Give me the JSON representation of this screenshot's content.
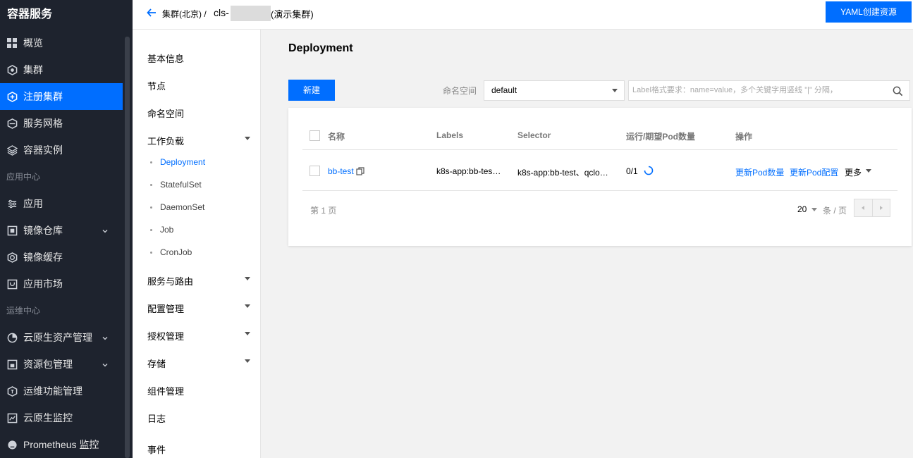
{
  "sidebar": {
    "brand": "容器服务",
    "items_top": [
      {
        "label": "概览",
        "icon": "grid-icon"
      },
      {
        "label": "集群",
        "icon": "cluster-icon"
      },
      {
        "label": "注册集群",
        "icon": "register-cluster-icon",
        "active": true
      },
      {
        "label": "服务网格",
        "icon": "mesh-icon"
      },
      {
        "label": "容器实例",
        "icon": "instance-icon"
      }
    ],
    "group_app": "应用中心",
    "items_app": [
      {
        "label": "应用",
        "icon": "app-icon"
      },
      {
        "label": "镜像仓库",
        "icon": "repo-icon"
      },
      {
        "label": "镜像缓存",
        "icon": "cache-icon"
      },
      {
        "label": "应用市场",
        "icon": "market-icon"
      }
    ],
    "group_ops": "运维中心",
    "items_ops": [
      {
        "label": "云原生资产管理",
        "icon": "asset-icon"
      },
      {
        "label": "资源包管理",
        "icon": "package-icon"
      },
      {
        "label": "运维功能管理",
        "icon": "ops-icon"
      },
      {
        "label": "云原生监控",
        "icon": "monitor-icon"
      },
      {
        "label": "Prometheus 监控",
        "icon": "prometheus-icon"
      }
    ]
  },
  "header": {
    "crumb": "集群(北京) /",
    "cls_prefix": "cls-",
    "cls_name": "(演示集群)",
    "yaml_button": "YAML创建资源"
  },
  "subnav": {
    "basic_info": "基本信息",
    "nodes": "节点",
    "namespaces": "命名空间",
    "workloads": "工作负载",
    "workload_items": [
      "Deployment",
      "StatefulSet",
      "DaemonSet",
      "Job",
      "CronJob"
    ],
    "service_routing": "服务与路由",
    "config": "配置管理",
    "auth": "授权管理",
    "storage": "存储",
    "components": "组件管理",
    "logs": "日志",
    "events": "事件"
  },
  "main": {
    "title": "Deployment",
    "new_button": "新建",
    "namespace_label": "命名空间",
    "namespace_value": "default",
    "search_placeholder": "Label格式要求：name=value，多个关键字用竖线 \"|\" 分隔，",
    "columns": [
      "名称",
      "Labels",
      "Selector",
      "运行/期望Pod数量",
      "操作"
    ],
    "row": {
      "name": "bb-test",
      "labels": "k8s-app:bb-tes…",
      "selector": "k8s-app:bb-test、qclo…",
      "pods": "0/1",
      "action_update_count": "更新Pod数量",
      "action_update_config": "更新Pod配置",
      "action_more": "更多"
    },
    "page_info": "第 1 页",
    "page_size": "20",
    "per_page": "条 / 页"
  },
  "colors": {
    "accent": "#006eff",
    "sidebar_bg": "#1e232e"
  }
}
